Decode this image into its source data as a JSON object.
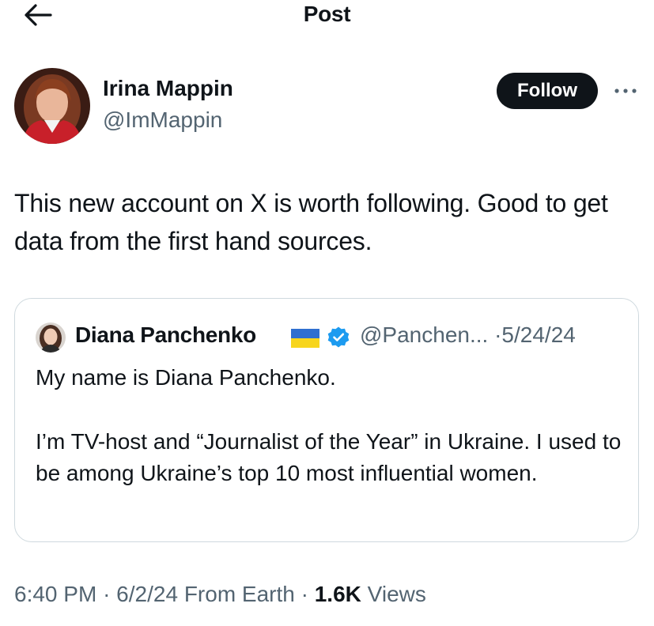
{
  "header": {
    "title": "Post",
    "back_icon": "arrow-left-icon"
  },
  "post": {
    "author": {
      "name": "Irina Mappin",
      "handle": "@ImMappin",
      "avatar_icon": "user-avatar"
    },
    "follow_label": "Follow",
    "more_icon": "more-dots-icon",
    "text": "This new account on X is worth following. Good to get data from the first hand sources.",
    "time": "6:40 PM",
    "date": "6/2/24",
    "source": "From Earth",
    "views_count": "1.6K",
    "views_label": "Views"
  },
  "quote": {
    "author_name": "Diana Panchenko",
    "flag_icon": "ukraine-flag-icon",
    "verified_icon": "verified-badge-icon",
    "handle": "@Panchen...",
    "date": "5/24/24",
    "paragraphs": [
      "My name is Diana Panchenko.",
      "I’m TV-host and “Journalist of the Year” in Ukraine. I used to be among Ukraine’s top 10 most influential women."
    ]
  },
  "colors": {
    "text_primary": "#0f1419",
    "text_secondary": "#536471",
    "border": "#cfd9de",
    "verified_blue": "#1d9bf0",
    "follow_bg": "#0f1419"
  }
}
